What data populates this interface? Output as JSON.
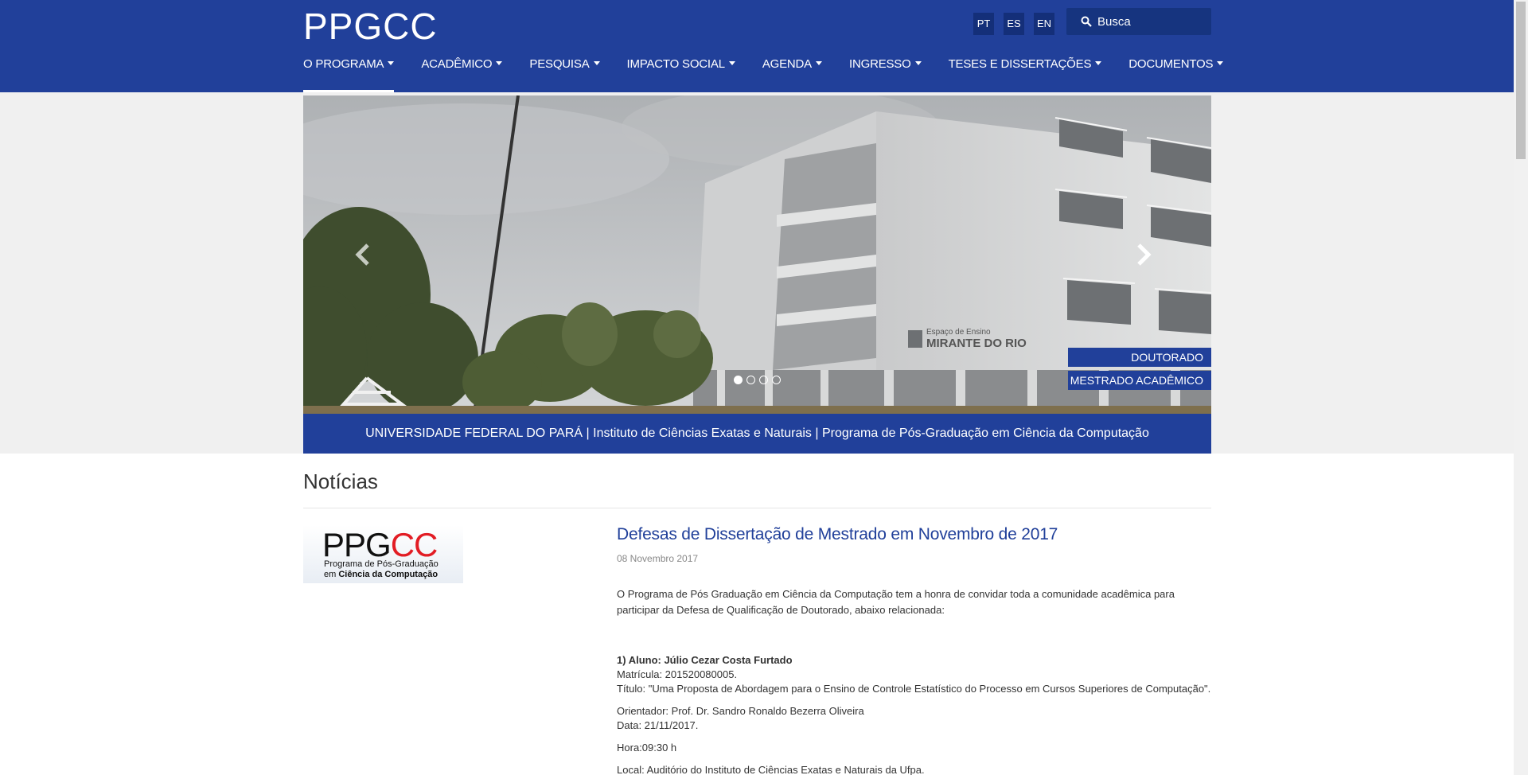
{
  "header": {
    "logo": "PPGCC",
    "languages": [
      "PT",
      "ES",
      "EN"
    ],
    "search_placeholder": "Busca",
    "nav": [
      "O PROGRAMA",
      "ACADÊMICO",
      "PESQUISA",
      "IMPACTO SOCIAL",
      "AGENDA",
      "INGRESSO",
      "TESES E DISSERTAÇÕES",
      "DOCUMENTOS"
    ]
  },
  "carousel": {
    "tags": [
      "DOUTORADO",
      "MESTRADO ACADÊMICO"
    ],
    "slide_count": 4,
    "active_slide": 1,
    "building_sign_1": "Espaço de Ensino",
    "building_sign_2": "MIRANTE DO RIO"
  },
  "university_bar": "UNIVERSIDADE FEDERAL DO PARÁ | Instituto de Ciências Exatas e Naturais | Programa de Pós-Graduação em Ciência da Computação",
  "news": {
    "section_title": "Notícias",
    "thumb": {
      "big_black": "PPG",
      "big_red": "CC",
      "line1": "Programa de Pós-Graduação",
      "line2_prefix": "em ",
      "line2_bold": "Ciência da Computação"
    },
    "article": {
      "title": "Defesas de Dissertação de Mestrado em Novembro de 2017",
      "date": "08 Novembro 2017",
      "intro": "O Programa de Pós Graduação em Ciência da Computação tem a honra de convidar toda a comunidade acadêmica para participar da Defesa de Qualificação de Doutorado, abaixo relacionada:",
      "student": "1) Aluno: Júlio Cezar Costa Furtado",
      "matricula": "Matrícula: 201520080005.",
      "titulo": "Título: \"Uma Proposta de Abordagem para o Ensino de Controle Estatístico do Processo em Cursos Superiores de Computação\".",
      "orientador": "Orientador: Prof. Dr. Sandro Ronaldo Bezerra Oliveira",
      "data": "Data: 21/11/2017.",
      "hora": "Hora:09:30 h",
      "local": "Local: Auditório  do Instituto de Ciências Exatas e Naturais da Ufpa."
    }
  },
  "colors": {
    "brand_blue": "#21409a",
    "dark_blue": "#142f79",
    "red": "#e21c24"
  }
}
